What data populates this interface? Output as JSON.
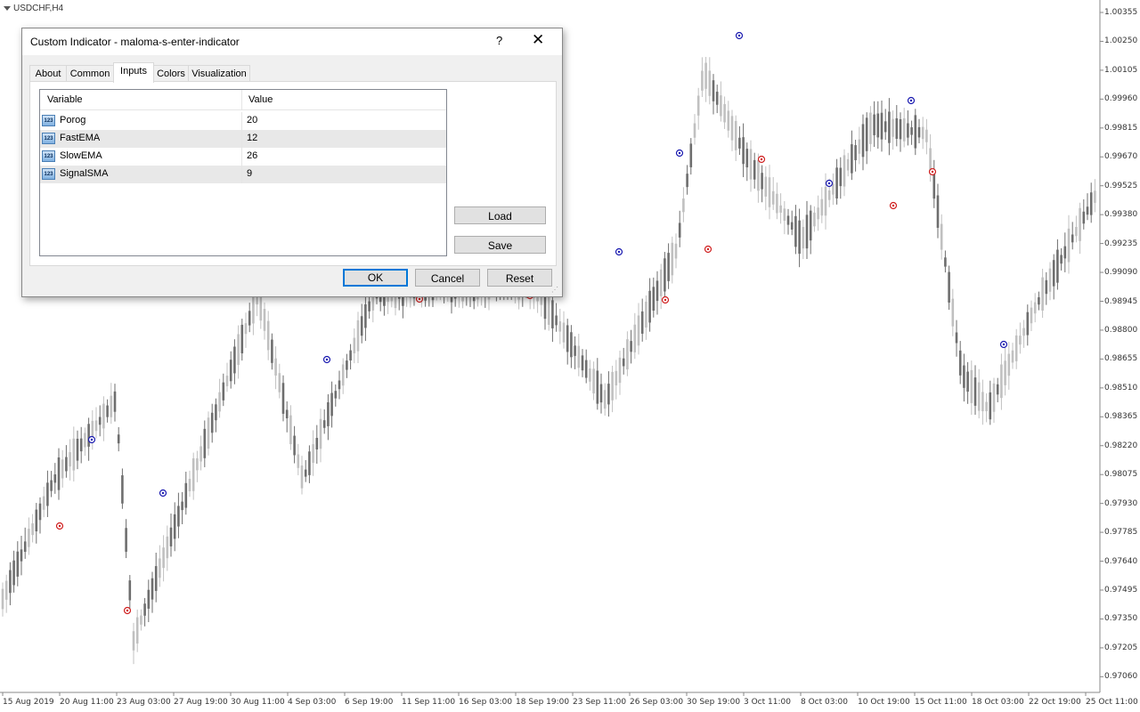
{
  "chart": {
    "symbol": "USDCHF,H4",
    "price_labels": [
      "1.00355",
      "1.00250",
      "1.00105",
      "0.99960",
      "0.99815",
      "0.99670",
      "0.99525",
      "0.99380",
      "0.99235",
      "0.99090",
      "0.98945",
      "0.98800",
      "0.98655",
      "0.98510",
      "0.98365",
      "0.98220",
      "0.98075",
      "0.97930",
      "0.97785",
      "0.97640",
      "0.97495",
      "0.97350",
      "0.97205",
      "0.97060"
    ],
    "time_labels": [
      "15 Aug 2019",
      "20 Aug 11:00",
      "23 Aug 03:00",
      "27 Aug 19:00",
      "30 Aug 11:00",
      "4 Sep 03:00",
      "6 Sep 19:00",
      "11 Sep 11:00",
      "16 Sep 03:00",
      "18 Sep 19:00",
      "23 Sep 11:00",
      "26 Sep 03:00",
      "30 Sep 19:00",
      "3 Oct 11:00",
      "8 Oct 03:00",
      "10 Oct 19:00",
      "15 Oct 11:00",
      "18 Oct 03:00",
      "22 Oct 19:00",
      "25 Oct 11:00"
    ],
    "colors": {
      "bull": "#c0c0c0",
      "bear": "#6e6e6e",
      "buy_signal": "#1a1ab0",
      "sell_signal": "#d02020",
      "grid_axis": "#c0c0c0"
    }
  },
  "dialog": {
    "title": "Custom Indicator - maloma-s-enter-indicator",
    "help_symbol": "?",
    "close_symbol": "✕",
    "tabs": [
      {
        "label": "About",
        "active": false
      },
      {
        "label": "Common",
        "active": false
      },
      {
        "label": "Inputs",
        "active": true
      },
      {
        "label": "Colors",
        "active": false
      },
      {
        "label": "Visualization",
        "active": false
      }
    ],
    "inputs_table": {
      "headers": {
        "variable": "Variable",
        "value": "Value"
      },
      "type_icon": "123",
      "rows": [
        {
          "name": "Porog",
          "value": "20"
        },
        {
          "name": "FastEMA",
          "value": "12"
        },
        {
          "name": "SlowEMA",
          "value": "26"
        },
        {
          "name": "SignalSMA",
          "value": "9"
        }
      ]
    },
    "buttons": {
      "load": "Load",
      "save": "Save",
      "ok": "OK",
      "cancel": "Cancel",
      "reset": "Reset"
    }
  }
}
